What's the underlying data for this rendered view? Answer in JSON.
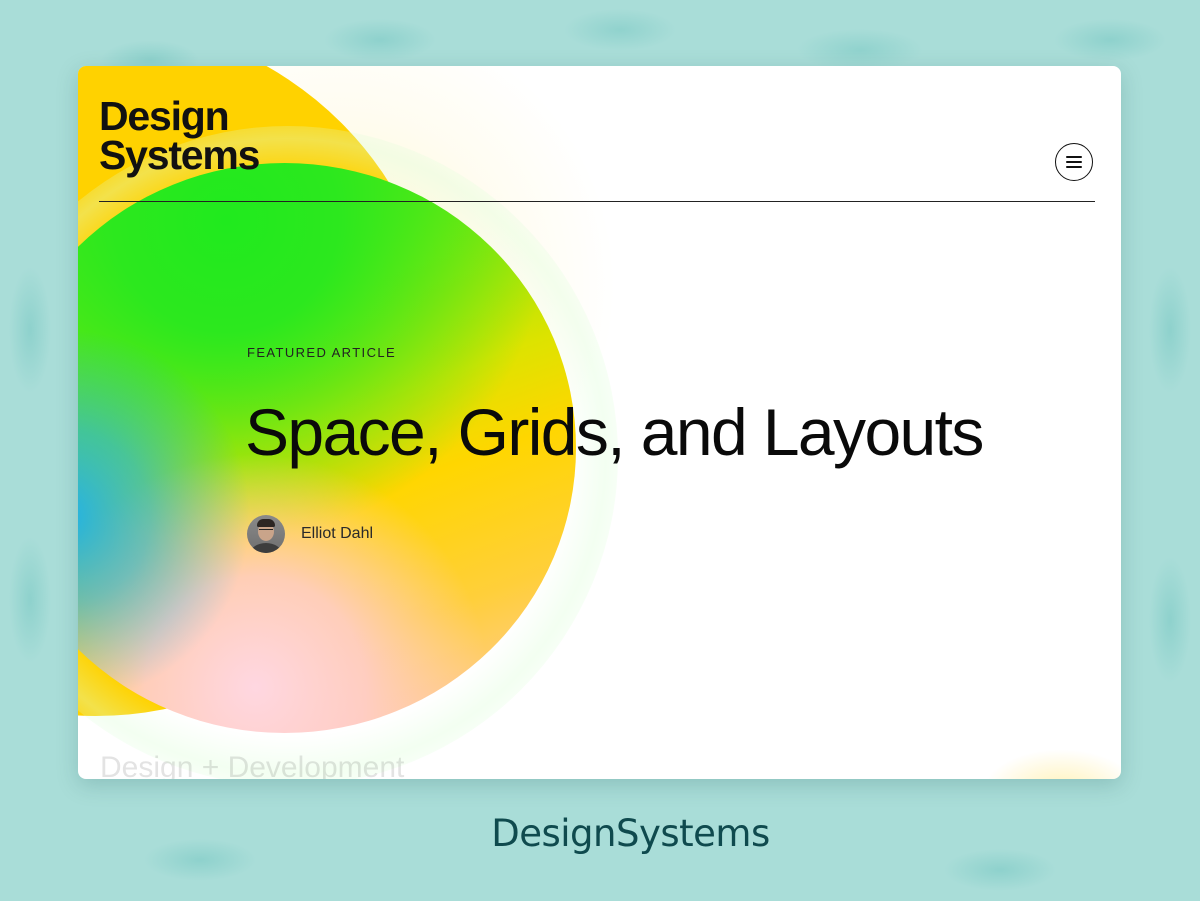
{
  "site": {
    "logo_line1": "Design",
    "logo_line2": "Systems"
  },
  "header": {
    "menu_icon": "hamburger-icon"
  },
  "hero": {
    "eyebrow": "FEATURED ARTICLE",
    "title": "Space, Grids, and Layouts",
    "author_name": "Elliot Dahl"
  },
  "next_section": {
    "label": "Design + Development"
  },
  "caption": {
    "text": "DesignSystems"
  },
  "colors": {
    "backdrop": "#a9ddd8",
    "blob_yellow": "#ffd200",
    "blob_green": "#20ea1e",
    "blob_blue": "#14aff5",
    "caption": "#0f4a4e"
  }
}
